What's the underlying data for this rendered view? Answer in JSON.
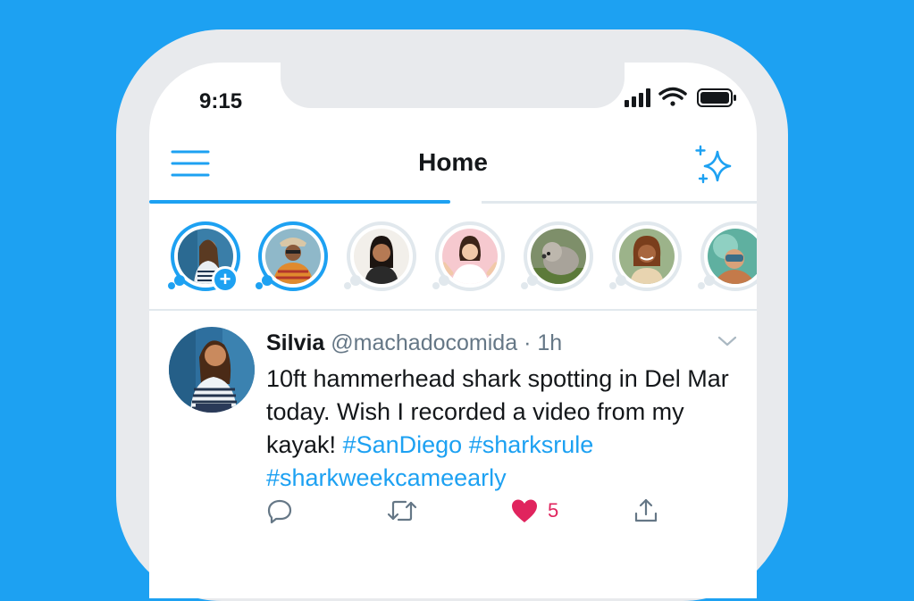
{
  "status_bar": {
    "time": "9:15",
    "icons": [
      "cellular-signal-icon",
      "wifi-icon",
      "battery-icon"
    ]
  },
  "header": {
    "title": "Home",
    "left_icon": "hamburger-menu-icon",
    "right_icon": "sparkle-icon"
  },
  "colors": {
    "brand": "#1da1f2",
    "text": "#14171a",
    "muted": "#657786",
    "like": "#e0245e",
    "border": "#e1e8ed"
  },
  "fleets": [
    {
      "state": "own",
      "has_add_badge": true,
      "add_glyph": "+"
    },
    {
      "state": "unseen"
    },
    {
      "state": "seen"
    },
    {
      "state": "seen"
    },
    {
      "state": "seen"
    },
    {
      "state": "seen"
    },
    {
      "state": "seen"
    }
  ],
  "tweet": {
    "name": "Silvia",
    "handle": "@machadocomida",
    "separator": "·",
    "time": "1h",
    "text_plain": "10ft hammerhead shark spotting in Del Mar today. Wish I recorded a video from my kayak!",
    "hashtags": [
      "#SanDiego",
      "#sharksrule",
      "#sharkweekcameearly"
    ],
    "menu_icon": "chevron-down-icon",
    "actions": {
      "reply_icon": "reply-icon",
      "retweet_icon": "retweet-icon",
      "like_icon": "heart-icon",
      "like_count": "5",
      "share_icon": "share-icon"
    }
  }
}
